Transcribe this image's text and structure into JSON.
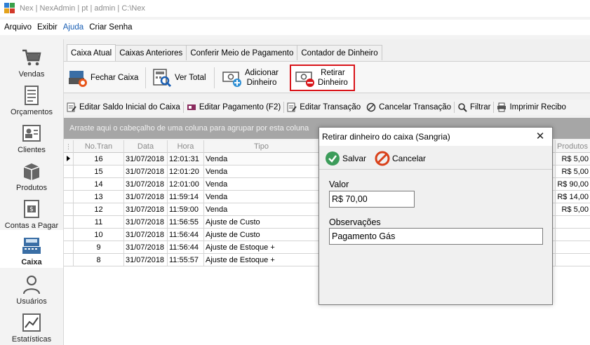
{
  "window": {
    "title": "Nex | NexAdmin | pt | admin | C:\\Nex"
  },
  "menu": [
    {
      "label": "Arquivo"
    },
    {
      "label": "Exibir"
    },
    {
      "label": "Ajuda"
    },
    {
      "label": "Criar Senha"
    }
  ],
  "sidebar": {
    "items": [
      {
        "label": "Vendas"
      },
      {
        "label": "Orçamentos"
      },
      {
        "label": "Clientes"
      },
      {
        "label": "Produtos"
      },
      {
        "label": "Contas a Pagar"
      },
      {
        "label": "Caixa"
      },
      {
        "label": "Usuários"
      },
      {
        "label": "Estatísticas"
      }
    ]
  },
  "tabs": [
    {
      "label": "Caixa Atual"
    },
    {
      "label": "Caixas Anteriores"
    },
    {
      "label": "Conferir Meio de Pagamento"
    },
    {
      "label": "Contador de Dinheiro"
    }
  ],
  "ribbon": {
    "fechar_caixa": "Fechar Caixa",
    "ver_total": "Ver Total",
    "adicionar_line1": "Adicionar",
    "adicionar_line2": "Dinheiro",
    "retirar_line1": "Retirar",
    "retirar_line2": "Dinheiro"
  },
  "toolbar": {
    "editar_saldo": "Editar Saldo Inicial do Caixa",
    "editar_pagamento": "Editar Pagamento (F2)",
    "editar_transacao": "Editar Transação",
    "cancelar_transacao": "Cancelar Transação",
    "filtrar": "Filtrar",
    "imprimir": "Imprimir Recibo"
  },
  "group_panel": "Arraste aqui o cabeçalho de uma coluna para agrupar por esta coluna",
  "grid": {
    "columns": [
      "No.Tran",
      "Data",
      "Hora",
      "Tipo",
      "Produtos"
    ],
    "rows": [
      {
        "no": "16",
        "data": "31/07/2018",
        "hora": "12:01:31",
        "tipo": "Venda",
        "produtos": "R$ 5,00"
      },
      {
        "no": "15",
        "data": "31/07/2018",
        "hora": "12:01:20",
        "tipo": "Venda",
        "produtos": "R$ 5,00"
      },
      {
        "no": "14",
        "data": "31/07/2018",
        "hora": "12:01:00",
        "tipo": "Venda",
        "produtos": "R$ 90,00"
      },
      {
        "no": "13",
        "data": "31/07/2018",
        "hora": "11:59:14",
        "tipo": "Venda",
        "produtos": "R$ 14,00"
      },
      {
        "no": "12",
        "data": "31/07/2018",
        "hora": "11:59:00",
        "tipo": "Venda",
        "produtos": "R$ 5,00"
      },
      {
        "no": "11",
        "data": "31/07/2018",
        "hora": "11:56:55",
        "tipo": "Ajuste de Custo",
        "produtos": ""
      },
      {
        "no": "10",
        "data": "31/07/2018",
        "hora": "11:56:44",
        "tipo": "Ajuste de Custo",
        "produtos": ""
      },
      {
        "no": "9",
        "data": "31/07/2018",
        "hora": "11:56:44",
        "tipo": "Ajuste de Estoque +",
        "produtos": ""
      },
      {
        "no": "8",
        "data": "31/07/2018",
        "hora": "11:55:57",
        "tipo": "Ajuste de Estoque +",
        "produtos": ""
      }
    ]
  },
  "dialog": {
    "title": "Retirar dinheiro do caixa (Sangria)",
    "salvar": "Salvar",
    "cancelar": "Cancelar",
    "valor_label": "Valor",
    "valor_value": "R$ 70,00",
    "obs_label": "Observações",
    "obs_value": "Pagamento Gás"
  },
  "colors": {
    "highlight_border": "#d9141a",
    "group_panel_bg": "#a6a6a6",
    "accent_blue": "#1a5fb4"
  }
}
